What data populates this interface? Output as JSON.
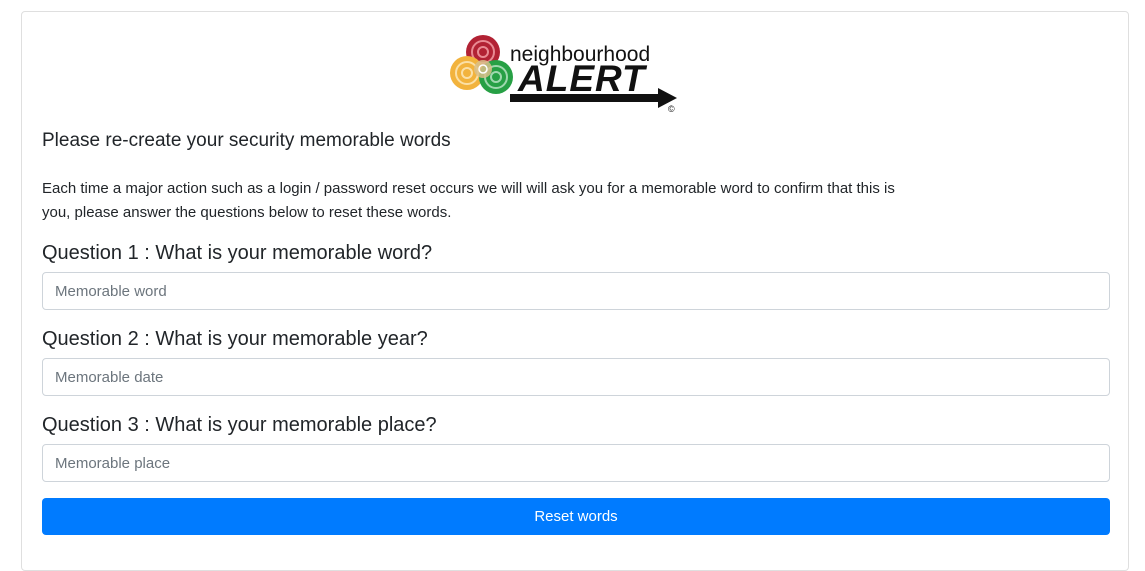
{
  "logo": {
    "line1": "neighbourhood",
    "line2": "ALERT",
    "mark": "©"
  },
  "form": {
    "heading": "Please re-create your security memorable words",
    "intro": "Each time a major action such as a login / password reset occurs we will will ask you for a memorable word to confirm that this is you, please answer the questions below to reset these words.",
    "questions": [
      {
        "label": "Question 1 : What is your memorable word?",
        "placeholder": "Memorable word",
        "value": ""
      },
      {
        "label": "Question 2 : What is your memorable year?",
        "placeholder": "Memorable date",
        "value": ""
      },
      {
        "label": "Question 3 : What is your memorable place?",
        "placeholder": "Memorable place",
        "value": ""
      }
    ],
    "submit_label": "Reset words"
  },
  "colors": {
    "primary": "#007bff",
    "logo_red": "#b22234",
    "logo_yellow": "#f2b33d",
    "logo_green": "#27a045"
  }
}
